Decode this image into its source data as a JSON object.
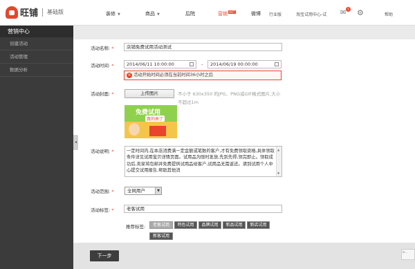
{
  "brand": {
    "name": "旺铺",
    "edition": "基础版"
  },
  "nav": {
    "decorate": "装修",
    "products": "商品",
    "backyard": "后院",
    "marketing": "营销",
    "marketing_badge": "HOT",
    "weibo": "微博",
    "industry": "行业版",
    "trial_center": "淘宝试用中心-试",
    "mail_count": "5",
    "help": "帮助"
  },
  "sidebar": {
    "title": "营销中心",
    "items": [
      {
        "label": "创建活动"
      },
      {
        "label": "活动管理"
      },
      {
        "label": "数据分析"
      }
    ]
  },
  "form": {
    "name_label": "活动名称:",
    "name_value": "店铺免费试用活动测试",
    "time_label": "活动时间:",
    "start_time": "2014/06/11 10:00:00",
    "time_sep": "-",
    "end_time": "2014/06/19 00:00:00",
    "error_text": "活动开始时间必须在当前时间36小时之后",
    "cover_label": "活动封面:",
    "upload_label": "上传图片",
    "upload_hint": "不小于 630x350 的JPG、PNG或GIF格式图片,大小不超过1m",
    "banner_text_1": "免费试用",
    "banner_text_2": "真的来了",
    "desc_label": "活动说明:",
    "desc_value": "一定时间内,在本店消费满一定金额或笔数的客户,才有免费领取资格,具体领取条件详见试用宝贝详情页面。试用品为限时发放,先到先得,领完即止。领取成功后,卖家将包邮并免费提供试用品给客户,试用品无需返还。请到试用个人中心提交试用报告,帮助其他消",
    "range_label": "活动范围:",
    "range_value": "全网用户",
    "tag_label": "活动标签:",
    "tag_value": "老客试用",
    "recommend_label": "推荐标签:",
    "recommend_tags": [
      "老客试用",
      "特色试用",
      "品牌试用",
      "新品试用",
      "新店试用",
      "新客试用"
    ]
  },
  "footer": {
    "next_label": "下一步",
    "corner_text": "Ie..."
  }
}
